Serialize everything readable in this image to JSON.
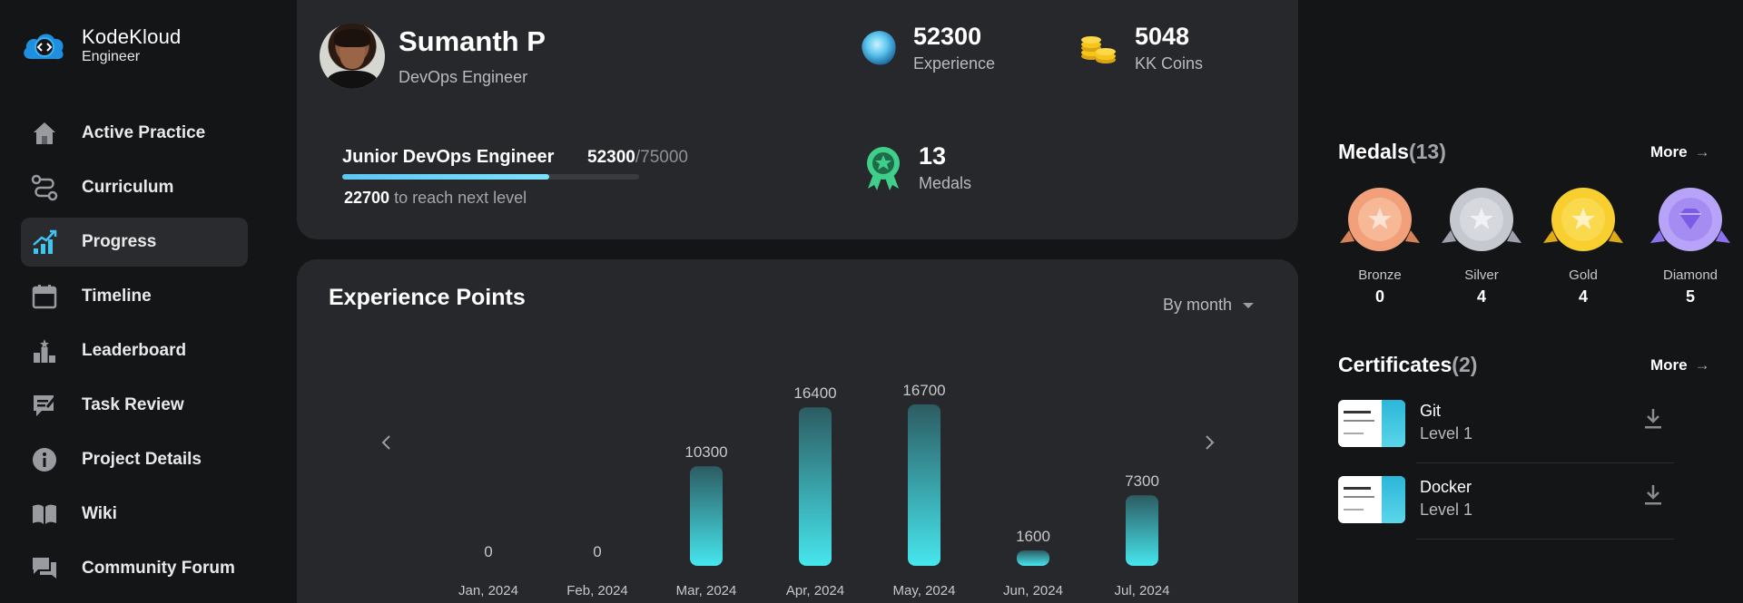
{
  "brand": {
    "name": "KodeKloud",
    "sub": "Engineer"
  },
  "nav": [
    {
      "label": "Active Practice",
      "icon": "home-icon",
      "active": false
    },
    {
      "label": "Curriculum",
      "icon": "route-icon",
      "active": false
    },
    {
      "label": "Progress",
      "icon": "progress-chart-icon",
      "active": true
    },
    {
      "label": "Timeline",
      "icon": "calendar-icon",
      "active": false
    },
    {
      "label": "Leaderboard",
      "icon": "leaderboard-icon",
      "active": false
    },
    {
      "label": "Task Review",
      "icon": "review-icon",
      "active": false
    },
    {
      "label": "Project Details",
      "icon": "info-icon",
      "active": false
    },
    {
      "label": "Wiki",
      "icon": "book-icon",
      "active": false
    },
    {
      "label": "Community Forum",
      "icon": "chat-icon",
      "active": false
    }
  ],
  "profile": {
    "name": "Sumanth P",
    "role": "DevOps Engineer",
    "experience": {
      "value": "52300",
      "label": "Experience"
    },
    "coins": {
      "value": "5048",
      "label": "KK Coins"
    },
    "medals": {
      "value": "13",
      "label": "Medals"
    },
    "level": {
      "title": "Junior DevOps Engineer",
      "current": "52300",
      "max": "/75000",
      "progress": 0.6973,
      "remaining": "22700",
      "remaining_text": " to reach next level"
    }
  },
  "xp": {
    "title": "Experience Points",
    "filter": "By month"
  },
  "chart_data": {
    "type": "bar",
    "categories": [
      "Jan, 2024",
      "Feb, 2024",
      "Mar, 2024",
      "Apr, 2024",
      "May, 2024",
      "Jun, 2024",
      "Jul, 2024"
    ],
    "values": [
      0,
      0,
      10300,
      16400,
      16700,
      1600,
      7300
    ],
    "title": "Experience Points",
    "xlabel": "",
    "ylabel": "",
    "ylim": [
      0,
      16700
    ],
    "grid": false,
    "colors": {
      "bar_top": "#2c5c62",
      "bar_bottom": "#46e6ee",
      "label": "#c7c8cb"
    }
  },
  "medals_panel": {
    "title": "Medals",
    "count": "(13)",
    "more": "More",
    "items": [
      {
        "name": "Bronze",
        "count": "0",
        "color": "#f2a07a",
        "ribbon": "#d9825a"
      },
      {
        "name": "Silver",
        "count": "4",
        "color": "#c6c8cf",
        "ribbon": "#9ea1ab"
      },
      {
        "name": "Gold",
        "count": "4",
        "color": "#f8cf2e",
        "ribbon": "#e0aa15"
      },
      {
        "name": "Diamond",
        "count": "5",
        "color": "#b7a3f7",
        "ribbon": "#8d72ee"
      }
    ]
  },
  "certificates_panel": {
    "title": "Certificates",
    "count": "(2)",
    "more": "More",
    "items": [
      {
        "name": "Git",
        "level": "Level 1"
      },
      {
        "name": "Docker",
        "level": "Level 1"
      }
    ]
  },
  "colors": {
    "accent": "#46e6ee",
    "card": "#27282b",
    "bg": "#141517"
  }
}
